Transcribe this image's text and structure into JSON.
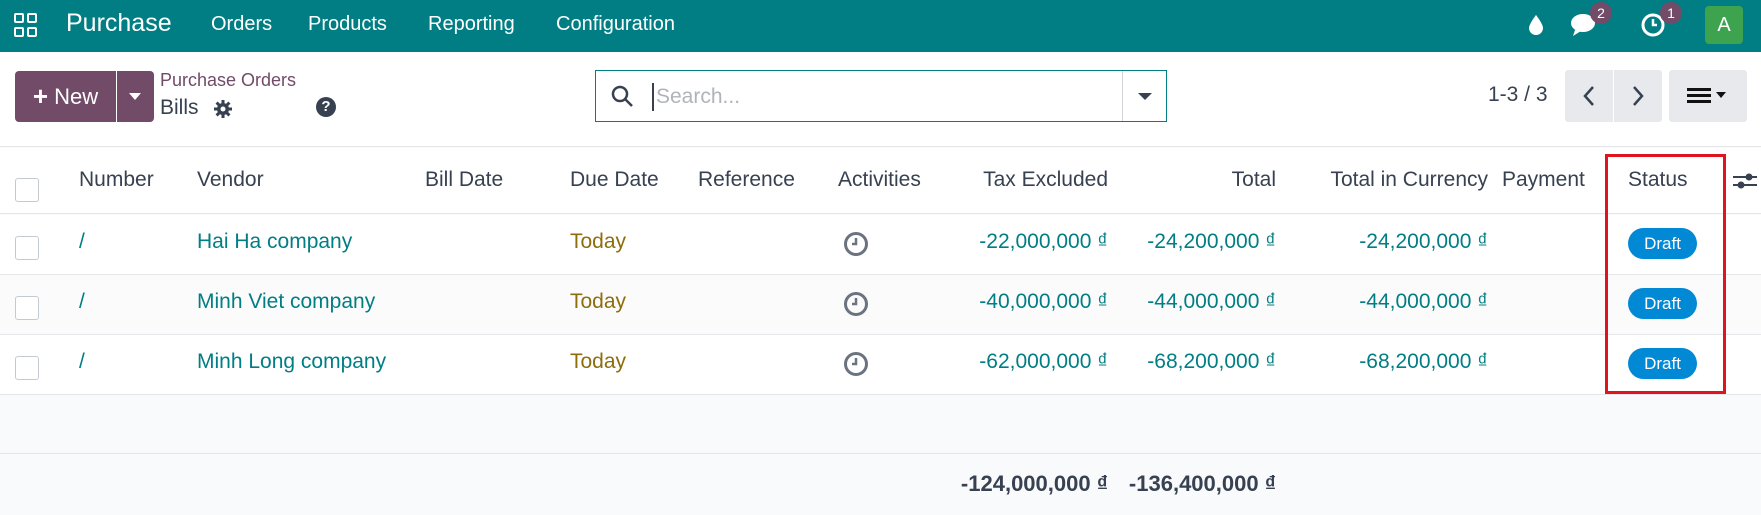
{
  "topbar": {
    "app_name": "Purchase",
    "menu": [
      "Orders",
      "Products",
      "Reporting",
      "Configuration"
    ],
    "messages_count": "2",
    "activities_count": "1",
    "avatar_letter": "A"
  },
  "control_panel": {
    "new_label": "New",
    "breadcrumb_parent": "Purchase Orders",
    "breadcrumb_current": "Bills",
    "search_placeholder": "Search...",
    "pager": "1-3 / 3"
  },
  "table": {
    "columns": [
      "Number",
      "Vendor",
      "Bill Date",
      "Due Date",
      "Reference",
      "Activities",
      "Tax Excluded",
      "Total",
      "Total in Currency",
      "Payment",
      "Status"
    ],
    "rows": [
      {
        "number": "/",
        "vendor": "Hai Ha company",
        "bill_date": "",
        "due_date": "Today",
        "reference": "",
        "tax_excluded": "-22,000,000 ₫",
        "total": "-24,200,000 ₫",
        "total_currency": "-24,200,000 ₫",
        "payment": "",
        "status": "Draft"
      },
      {
        "number": "/",
        "vendor": "Minh Viet company",
        "bill_date": "",
        "due_date": "Today",
        "reference": "",
        "tax_excluded": "-40,000,000 ₫",
        "total": "-44,000,000 ₫",
        "total_currency": "-44,000,000 ₫",
        "payment": "",
        "status": "Draft"
      },
      {
        "number": "/",
        "vendor": "Minh Long company",
        "bill_date": "",
        "due_date": "Today",
        "reference": "",
        "tax_excluded": "-62,000,000 ₫",
        "total": "-68,200,000 ₫",
        "total_currency": "-68,200,000 ₫",
        "payment": "",
        "status": "Draft"
      }
    ],
    "totals": {
      "tax_excluded": "-124,000,000 ₫",
      "total": "-136,400,000 ₫"
    }
  },
  "colors": {
    "brand": "#017e84",
    "primary": "#714b67",
    "status_draft": "#0289d6",
    "highlight": "#e0141e"
  }
}
